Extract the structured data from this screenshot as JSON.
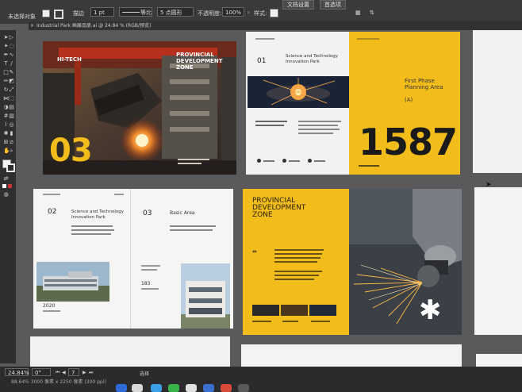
{
  "control_bar": {
    "selection_label": "未选择对象",
    "stroke_label": "描边",
    "stroke_value": "1 pt",
    "line_label": "等比",
    "brush_value": "5 点圆形",
    "opacity_label": "不透明度:",
    "opacity_value": "100%",
    "style_label": "样式:",
    "doc_setup_button": "文档设置",
    "prefs_button": "首选项"
  },
  "document_tab": {
    "title": "Industrial Park 画展品册.ai @ 24.84 % (RGB/预览)"
  },
  "artboards": {
    "hitech": {
      "tag": "HI-TECH",
      "title_line1": "PROVINCIAL",
      "title_line2": "DEVELOPMENT",
      "title_line3": "ZONE",
      "number": "03"
    },
    "planning": {
      "number": "01",
      "heading_line1": "Science and Technology",
      "heading_line2": "Innovation Park",
      "title_line1": "First Phase",
      "title_line2": "Planning Area",
      "marker": "(A)",
      "big_number": "1587"
    },
    "innovation": {
      "left_number": "02",
      "left_heading_line1": "Science and Technology",
      "left_heading_line2": "Innovation Park",
      "right_number": "03",
      "right_heading": "Basic Area",
      "left_year": "2020",
      "right_value": "183"
    },
    "provincial": {
      "title_line1": "PROVINCIAL",
      "title_line2": "DEVELOPMENT",
      "title_line3": "ZONE",
      "asterisk": "✱"
    }
  },
  "status_bar": {
    "zoom": "24.84%",
    "rotation": "0°",
    "artboard_index": "7",
    "selection_mode": "选择",
    "info": "88.64% 3000 像素 x 2250 像素 (300 ppi)"
  },
  "colors": {
    "accent_yellow": "#f2bd1a",
    "canvas_gray": "#5b5b5d",
    "ui_dark": "#333335"
  }
}
